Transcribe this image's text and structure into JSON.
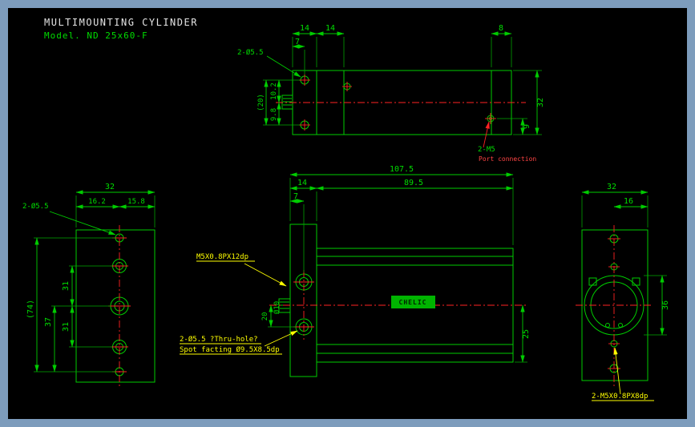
{
  "window": {
    "frame_color": "#7d9cbc",
    "canvas_color": "#000000"
  },
  "colors": {
    "line_green": "#00cc00",
    "centerline_red": "#ff2222",
    "note_yellow": "#ffff00",
    "title_white": "#e4e4e4"
  },
  "title_block": {
    "line1": "MULTIMOUNTING CYLINDER",
    "line2": "Model. ND 25x60-F"
  },
  "logo": {
    "brand": "CHELIC"
  },
  "top_view": {
    "dim_flange_width": "14",
    "dim_body_step": "14",
    "dim_port_offset": "8",
    "dim_hole_offset": "7",
    "dim_height_total": "(20)",
    "dim_upper": "10.2",
    "dim_lower": "9.8",
    "dim_body_height": "32",
    "dim_port_height": "9",
    "label_holes": "2-Ø5.5",
    "label_port": "2-M5",
    "label_port_note": "Port connection"
  },
  "front_view": {
    "dim_total_length": "107.5",
    "dim_flange_width": "14",
    "dim_body_length": "89.5",
    "dim_hole_offset": "7",
    "dim_hole_spacing": "20",
    "dim_rod_dia": "Ø10",
    "dim_port_offset": "25",
    "label_rod_thread": "M5X0.8PX12dp",
    "label_thru_hole_1": "2-Ø5.5 ?Thru-hole?",
    "label_thru_hole_2": "Spot facting Ø9.5X8.5dp"
  },
  "left_view": {
    "dim_width": "32",
    "dim_left": "16.2",
    "dim_right": "15.8",
    "dim_upper_spacing": "31",
    "dim_lower_spacing": "31",
    "dim_mount_spacing": "37",
    "dim_total_height": "(74)",
    "label_holes": "2-Ø5.5"
  },
  "right_view": {
    "dim_width": "32",
    "dim_half": "16",
    "dim_bore": "36",
    "label_thread": "2-M5X0.8PX8dp"
  }
}
